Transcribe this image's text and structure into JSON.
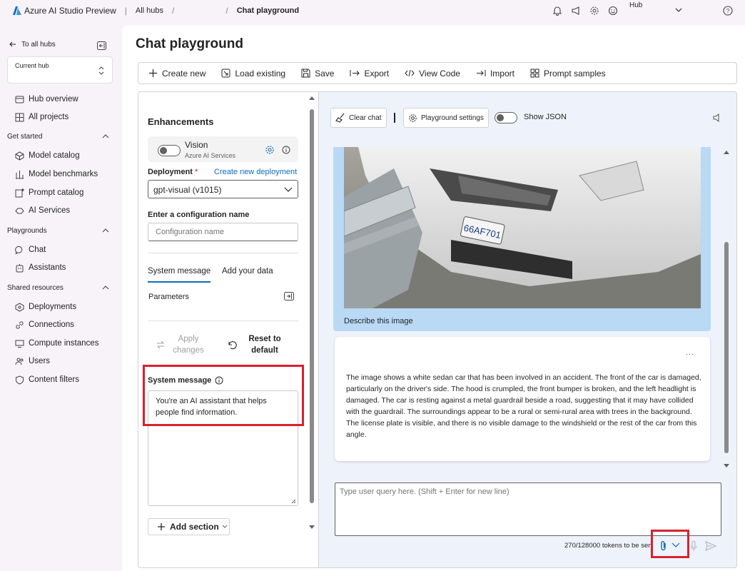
{
  "topbar": {
    "brand": "Azure AI Studio Preview",
    "breadcrumb_all_hubs": "All hubs",
    "breadcrumb_current": "Chat playground",
    "hub_label": "Hub"
  },
  "leftnav": {
    "to_all_hubs": "To all hubs",
    "current_hub_label": "Current hub",
    "items_top": [
      {
        "label": "Hub overview",
        "icon": "hub-overview-icon"
      },
      {
        "label": "All projects",
        "icon": "grid-icon"
      }
    ],
    "group_get_started": "Get started",
    "items_get_started": [
      {
        "label": "Model catalog",
        "icon": "cube-icon"
      },
      {
        "label": "Model benchmarks",
        "icon": "benchmark-icon"
      },
      {
        "label": "Prompt catalog",
        "icon": "prompt-icon"
      },
      {
        "label": "AI Services",
        "icon": "ai-services-icon"
      }
    ],
    "group_playgrounds": "Playgrounds",
    "items_playgrounds": [
      {
        "label": "Chat",
        "icon": "chat-icon"
      },
      {
        "label": "Assistants",
        "icon": "assistant-icon"
      }
    ],
    "group_shared": "Shared resources",
    "items_shared": [
      {
        "label": "Deployments",
        "icon": "deploy-icon"
      },
      {
        "label": "Connections",
        "icon": "link-icon"
      },
      {
        "label": "Compute instances",
        "icon": "compute-icon"
      },
      {
        "label": "Users",
        "icon": "users-icon"
      },
      {
        "label": "Content filters",
        "icon": "shield-icon"
      }
    ]
  },
  "page": {
    "title": "Chat playground"
  },
  "toolbar": {
    "create_new": "Create new",
    "load_existing": "Load existing",
    "save": "Save",
    "export": "Export",
    "view_code": "View Code",
    "import": "Import",
    "prompt_samples": "Prompt samples"
  },
  "config": {
    "enhancements_title": "Enhancements",
    "vision_title": "Vision",
    "vision_subtitle": "Azure AI Services",
    "deployment_label": "Deployment",
    "deployment_required": "*",
    "create_new_deployment": "Create new deployment",
    "deployment_value": "gpt-visual (v1015)",
    "config_name_label": "Enter a configuration name",
    "config_name_placeholder": "Configuration name",
    "tab_system_message": "System message",
    "tab_add_data": "Add your data",
    "parameters_label": "Parameters",
    "apply_changes": "Apply changes",
    "reset_to_default": "Reset to default",
    "system_message_label": "System message",
    "system_message_value": "You're an AI assistant that helps people find information.",
    "add_section": "Add section"
  },
  "chat": {
    "clear_chat": "Clear chat",
    "playground_settings": "Playground settings",
    "show_json": "Show JSON",
    "user_message": "Describe this image",
    "bot_dots": "...",
    "bot_message": "The image shows a white sedan car that has been involved in an accident. The front of the car is damaged, particularly on the driver's side. The hood is crumpled, the front bumper is broken, and the left headlight is damaged. The car is resting against a metal guardrail beside a road, suggesting that it may have collided with the guardrail. The surroundings appear to be a rural or semi-rural area with trees in the background. The license plate is visible, and there is no visible damage to the windshield or the rest of the car from this angle.",
    "query_placeholder": "Type user query here. (Shift + Enter for new line)",
    "tokens": "270/128000 tokens to be sen",
    "license_plate": "66AF701"
  },
  "colors": {
    "accent": "#0f6cbd",
    "highlight": "#d9202e",
    "user_bubble": "#b9d9f5"
  }
}
